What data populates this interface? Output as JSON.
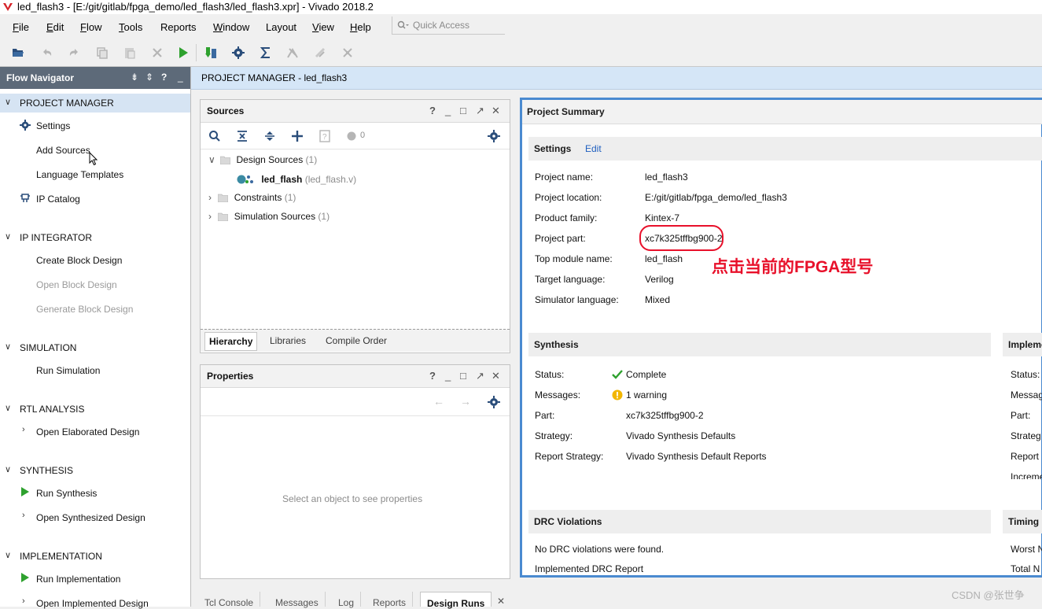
{
  "window": {
    "title": "led_flash3 - [E:/git/gitlab/fpga_demo/led_flash3/led_flash3.xpr] - Vivado 2018.2"
  },
  "menu": {
    "items": [
      {
        "first": "F",
        "rest": "ile"
      },
      {
        "first": "E",
        "rest": "dit"
      },
      {
        "first": "F",
        "rest": "low"
      },
      {
        "first": "T",
        "rest": "ools"
      },
      {
        "first": "",
        "rest": "Reports"
      },
      {
        "first": "W",
        "rest": "indow"
      },
      {
        "first": "",
        "rest": "Layout"
      },
      {
        "first": "V",
        "rest": "iew"
      },
      {
        "first": "H",
        "rest": "elp"
      }
    ],
    "quick_access_placeholder": "Quick Access"
  },
  "toolbar": {
    "icons": [
      "open-project-icon",
      "undo-icon",
      "redo-icon",
      "copy-icon",
      "paste-icon",
      "delete-icon",
      "run-icon",
      "program-device-icon",
      "settings-icon",
      "sigma-icon",
      "run-cancel-icon",
      "reset-icon",
      "clear-icon"
    ]
  },
  "flow_navigator": {
    "title": "Flow Navigator",
    "sections": [
      {
        "label": "PROJECT MANAGER",
        "items": [
          "Settings",
          "Add Sources",
          "Language Templates",
          "IP Catalog"
        ]
      },
      {
        "label": "IP INTEGRATOR",
        "items": [
          "Create Block Design",
          "Open Block Design",
          "Generate Block Design"
        ]
      },
      {
        "label": "SIMULATION",
        "items": [
          "Run Simulation"
        ]
      },
      {
        "label": "RTL ANALYSIS",
        "items": [
          "Open Elaborated Design"
        ]
      },
      {
        "label": "SYNTHESIS",
        "items": [
          "Run Synthesis",
          "Open Synthesized Design"
        ]
      },
      {
        "label": "IMPLEMENTATION",
        "items": [
          "Run Implementation",
          "Open Implemented Design"
        ]
      }
    ]
  },
  "main_header": {
    "title": "PROJECT MANAGER - led_flash3"
  },
  "sources": {
    "title": "Sources",
    "count": "0",
    "tree": [
      {
        "label": "Design Sources",
        "count": "(1)"
      },
      {
        "label": "led_flash",
        "file": "(led_flash.v)"
      },
      {
        "label": "Constraints",
        "count": "(1)"
      },
      {
        "label": "Simulation Sources",
        "count": "(1)"
      }
    ],
    "tabs": [
      "Hierarchy",
      "Libraries",
      "Compile Order"
    ]
  },
  "properties": {
    "title": "Properties",
    "empty_text": "Select an object to see properties"
  },
  "summary": {
    "title": "Project Summary",
    "settings": {
      "title": "Settings",
      "edit_label": "Edit",
      "rows": [
        {
          "key": "Project name:",
          "value": "led_flash3"
        },
        {
          "key": "Project location:",
          "value": "E:/git/gitlab/fpga_demo/led_flash3"
        },
        {
          "key": "Product family:",
          "value": "Kintex-7"
        },
        {
          "key": "Project part:",
          "value": "xc7k325tffbg900-2"
        },
        {
          "key": "Top module name:",
          "value": "led_flash"
        },
        {
          "key": "Target language:",
          "value": "Verilog"
        },
        {
          "key": "Simulator language:",
          "value": "Mixed"
        }
      ]
    },
    "synthesis": {
      "title": "Synthesis",
      "rows": [
        {
          "key": "Status:",
          "value": "Complete"
        },
        {
          "key": "Messages:",
          "value": "1 warning"
        },
        {
          "key": "Part:",
          "value": "xc7k325tffbg900-2"
        },
        {
          "key": "Strategy:",
          "value": "Vivado Synthesis Defaults"
        },
        {
          "key": "Report Strategy:",
          "value": "Vivado Synthesis Default Reports"
        }
      ]
    },
    "implementation": {
      "title": "Impleme",
      "rows": [
        "Status:",
        "Messag",
        "Part:",
        "Strateg",
        "Report",
        "Increme"
      ]
    },
    "drc": {
      "title": "DRC Violations",
      "text": "No DRC violations were found.",
      "link": "Implemented DRC Report"
    },
    "timing": {
      "title": "Timing",
      "rows": [
        "Worst N",
        "Total N"
      ]
    }
  },
  "bottom_tabs": [
    "Tcl Console",
    "Messages",
    "Log",
    "Reports",
    "Design Runs"
  ],
  "annotation": "点击当前的FPGA型号",
  "watermark": "CSDN @张世争"
}
